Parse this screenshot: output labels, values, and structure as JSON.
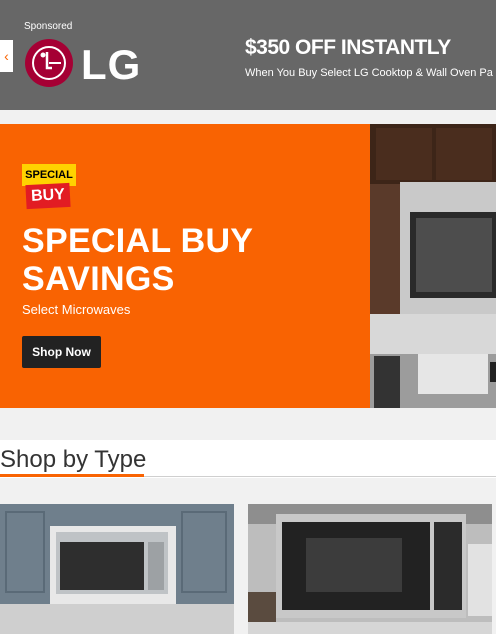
{
  "sponsored_banner": {
    "label": "Sponsored",
    "brand": "LG",
    "logo_letters": "LG",
    "headline": "$350 OFF INSTANTLY",
    "subline": "When You Buy Select LG Cooktop & Wall Oven Pa",
    "prev_icon": "chevron-left-icon",
    "colors": {
      "background": "#676767",
      "logo_red": "#a50034",
      "arrow": "#f96302"
    }
  },
  "hero": {
    "badge_top": "SPECIAL",
    "badge_bottom": "BUY",
    "title_line1": "SPECIAL BUY",
    "title_line2": "SAVINGS",
    "subtitle": "Select Microwaves",
    "cta_label": "Shop Now",
    "colors": {
      "background": "#f96302",
      "cta": "#222222"
    }
  },
  "shop_by_type": {
    "title": "Shop by Type",
    "accent_color": "#f96302",
    "items": [
      {
        "name": "over-the-range-microwave-image"
      },
      {
        "name": "countertop-microwave-image"
      }
    ]
  }
}
